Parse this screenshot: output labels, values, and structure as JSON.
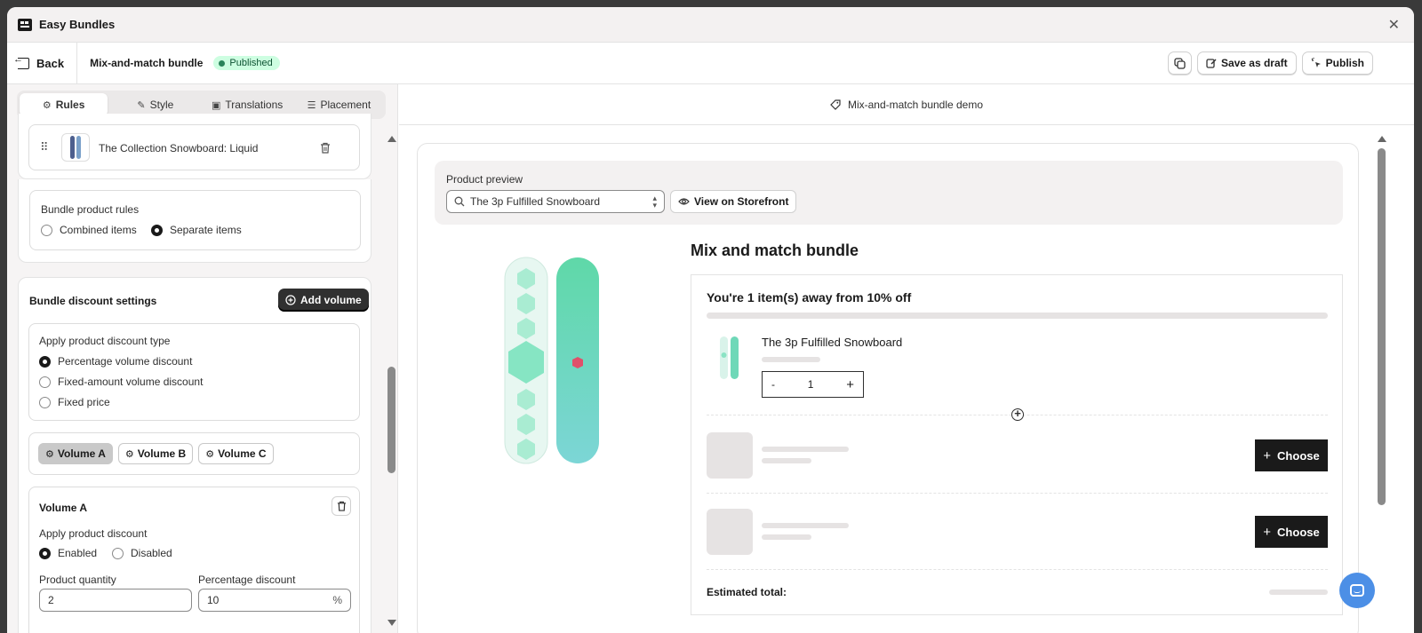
{
  "app": {
    "title": "Easy Bundles"
  },
  "header": {
    "back_label": "Back",
    "bundle_name": "Mix-and-match bundle",
    "status_badge": "Published",
    "save_draft_label": "Save as draft",
    "publish_label": "Publish"
  },
  "tabs": [
    {
      "label": "Rules",
      "icon": "badge-percent-icon",
      "active": true
    },
    {
      "label": "Style",
      "icon": "brush-icon",
      "active": false
    },
    {
      "label": "Translations",
      "icon": "translate-icon",
      "active": false
    },
    {
      "label": "Placement",
      "icon": "layout-icon",
      "active": false
    }
  ],
  "product_item": {
    "name": "The Collection Snowboard: Liquid"
  },
  "bundle_rules": {
    "title": "Bundle product rules",
    "options": [
      "Combined items",
      "Separate items"
    ],
    "selected": "Separate items"
  },
  "discount_settings": {
    "title": "Bundle discount settings",
    "add_volume_label": "Add volume",
    "type_title": "Apply product discount type",
    "types": [
      "Percentage volume discount",
      "Fixed-amount volume discount",
      "Fixed price"
    ],
    "selected_type": "Percentage volume discount",
    "volumes": [
      "Volume A",
      "Volume B",
      "Volume C"
    ],
    "active_volume": "Volume A"
  },
  "volume_a": {
    "title": "Volume A",
    "apply_label": "Apply product discount",
    "enabled_label": "Enabled",
    "disabled_label": "Disabled",
    "selected": "Enabled",
    "qty_label": "Product quantity",
    "qty_value": "2",
    "pct_label": "Percentage discount",
    "pct_value": "10",
    "pct_suffix": "%"
  },
  "preview": {
    "title": "Mix-and-match bundle demo",
    "product_preview_label": "Product preview",
    "selected_product": "The 3p Fulfilled Snowboard",
    "view_storefront_label": "View on Storefront",
    "bundle_title": "Mix and match bundle",
    "progress_text": "You're 1 item(s) away from 10% off",
    "item_name": "The 3p Fulfilled Snowboard",
    "quantity": "1",
    "minus": "-",
    "plus": "+",
    "choose_label": "Choose",
    "estimated_total_label": "Estimated total:"
  },
  "colors": {
    "badge_bg": "#cdfee1",
    "badge_dot": "#29845a",
    "dark_button": "#303030",
    "choose_button": "#1a1a1a",
    "chat_button": "#4c8fe6",
    "snowboard_mint": "#7fe0c2"
  }
}
